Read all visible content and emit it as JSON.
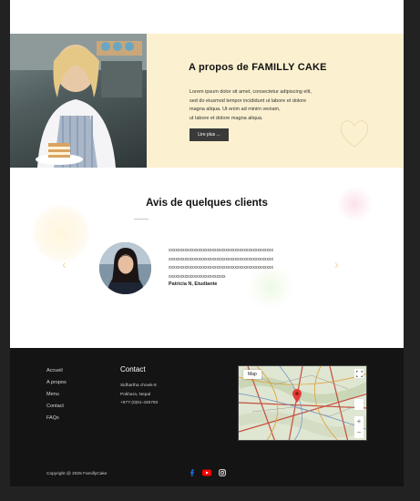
{
  "about": {
    "title": "A propos de FAMILLY CAKE",
    "text_lines": [
      "Lorem ipsum dolor sit amet, consectetur adipiscing elit,",
      "sed do eiusmod tempor incididunt ut labore et dolore",
      "magna aliqua. Ut enim ad minim veniam,",
      "ut labore et dolore magna aliqua."
    ],
    "button_label": "Lire plus ..."
  },
  "reviews": {
    "title": "Avis de quelques clients",
    "review_lines": [
      "xxxxxxxxxxxxxxxxxxxxxxxxxxxxxxxxxxxxxxxxxxxxxx",
      "xxxxxxxxxxxxxxxxxxxxxxxxxxxxxxxxxxxxxxxxxxxxxx",
      "xxxxxxxxxxxxxxxxxxxxxxxxxxxxxxxxxxxxxxxxxxxxxx",
      "xxxxxxxxxxxxxxxxxxxxxxxxx"
    ],
    "reviewer": "Patricia N,  Etudiante",
    "prev_glyph": "‹",
    "next_glyph": "›"
  },
  "footer": {
    "links": [
      "Accueil",
      "A propos",
      "Menu",
      "Contact",
      "FAQs"
    ],
    "contact_title": "Contact",
    "contact_lines": [
      "Sidhartha chowk-8",
      "Pokhara, Nepal",
      "+977-(0)61-426793"
    ],
    "map": {
      "label": "Map",
      "zoom_in": "+",
      "zoom_out": "−"
    },
    "copyright": "Copyright @ 2025 FamillyCake"
  },
  "colors": {
    "about_bg": "#fbf0cf",
    "footer_bg": "#141414",
    "facebook": "#1877f2",
    "youtube": "#ff0000",
    "map_pin": "#e53935"
  },
  "icons": [
    "heart-outline-icon",
    "chevron-left-icon",
    "chevron-right-icon",
    "fullscreen-icon",
    "map-pin-icon",
    "facebook-icon",
    "youtube-icon",
    "instagram-icon"
  ]
}
